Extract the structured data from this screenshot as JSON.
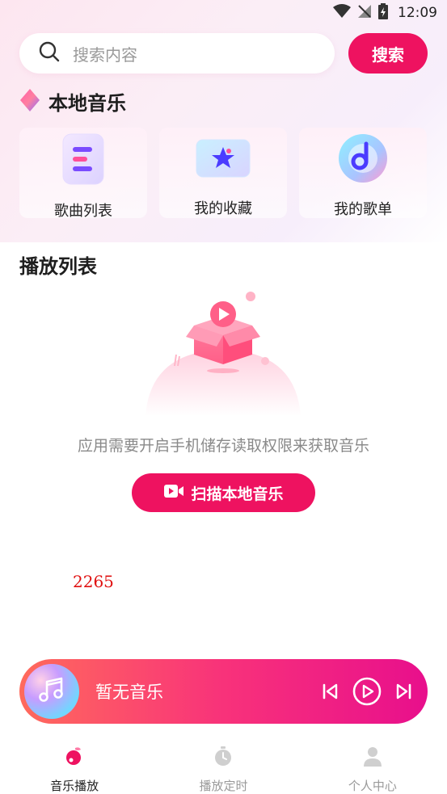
{
  "status_bar": {
    "time": "12:09"
  },
  "search": {
    "placeholder": "搜索内容",
    "button_label": "搜索"
  },
  "local_music": {
    "title": "本地音乐",
    "cards": [
      {
        "label": "歌曲列表",
        "icon": "song-list-icon"
      },
      {
        "label": "我的收藏",
        "icon": "favorites-star-icon"
      },
      {
        "label": "我的歌单",
        "icon": "playlist-disc-icon"
      }
    ]
  },
  "playlist": {
    "title": "播放列表",
    "empty_message": "应用需要开启手机储存读取权限来获取音乐",
    "scan_button": "扫描本地音乐"
  },
  "stray_number": "2265",
  "player": {
    "title": "暂无音乐"
  },
  "tabs": [
    {
      "label": "音乐播放",
      "icon": "music-play-icon",
      "active": true
    },
    {
      "label": "播放定时",
      "icon": "timer-icon",
      "active": false
    },
    {
      "label": "个人中心",
      "icon": "person-icon",
      "active": false
    }
  ],
  "colors": {
    "accent": "#ee1260",
    "text": "#222222",
    "muted": "#9a9a9a"
  }
}
